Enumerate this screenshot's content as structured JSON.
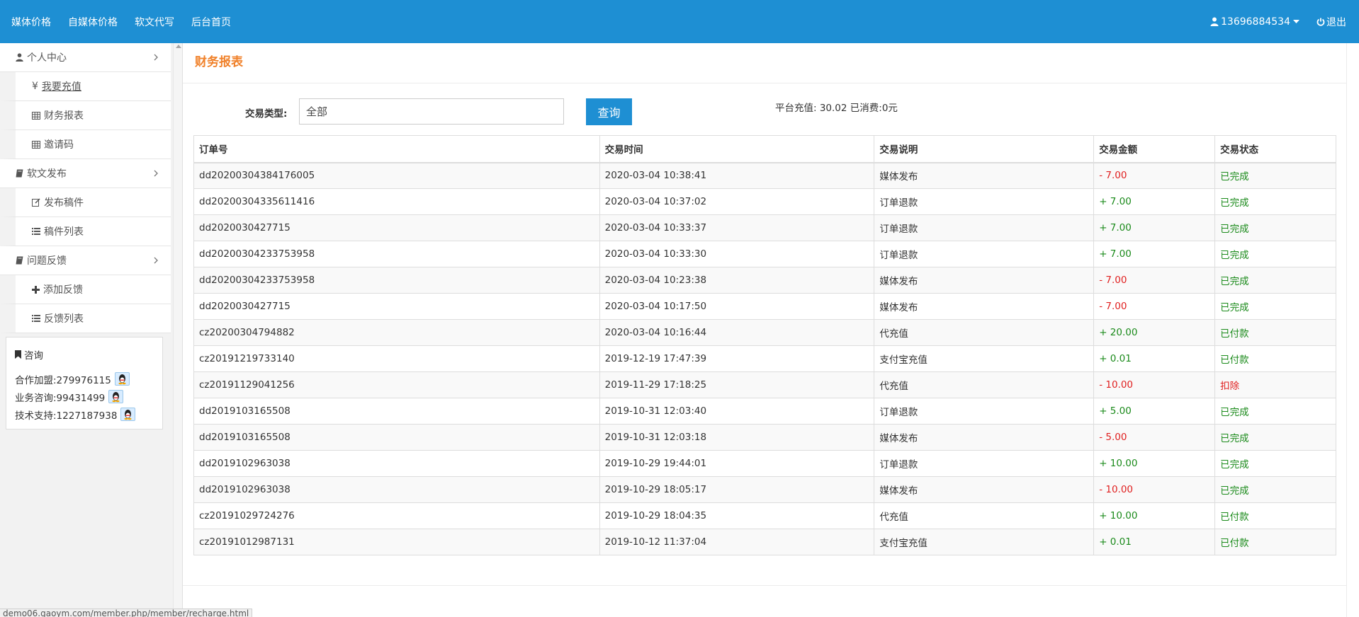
{
  "topnav": {
    "links": [
      "媒体价格",
      "自媒体价格",
      "软文代写",
      "后台首页"
    ],
    "user": "13696884534",
    "logout": "退出"
  },
  "sidebar": {
    "groups": [
      {
        "label": "个人中心",
        "icon": "user-icon",
        "items": [
          {
            "label": "我要充值",
            "icon": "yen-icon"
          },
          {
            "label": "财务报表",
            "icon": "table-icon"
          },
          {
            "label": "邀请码",
            "icon": "table-icon"
          }
        ]
      },
      {
        "label": "软文发布",
        "icon": "book-icon",
        "items": [
          {
            "label": "发布稿件",
            "icon": "edit-icon"
          },
          {
            "label": "稿件列表",
            "icon": "list-icon"
          }
        ]
      },
      {
        "label": "问题反馈",
        "icon": "book-icon",
        "items": [
          {
            "label": "添加反馈",
            "icon": "plus-icon"
          },
          {
            "label": "反馈列表",
            "icon": "list-icon"
          }
        ]
      }
    ],
    "consult": {
      "title": "咨询",
      "rows": [
        "合作加盟:279976115",
        "业务咨询:99431499",
        "技术支持:1227187938"
      ]
    }
  },
  "main": {
    "title": "财务报表",
    "filter_label": "交易类型:",
    "filter_value": "全部",
    "query_label": "查询",
    "summary": "平台充值: 30.02 已消费:0元",
    "columns": [
      "订单号",
      "交易时间",
      "交易说明",
      "交易金额",
      "交易状态"
    ],
    "rows": [
      [
        "dd20200304384176005",
        "2020-03-04 10:38:41",
        "媒体发布",
        "- 7.00",
        "已完成"
      ],
      [
        "dd20200304335611416",
        "2020-03-04 10:37:02",
        "订单退款",
        "+ 7.00",
        "已完成"
      ],
      [
        "dd2020030427715",
        "2020-03-04 10:33:37",
        "订单退款",
        "+ 7.00",
        "已完成"
      ],
      [
        "dd20200304233753958",
        "2020-03-04 10:33:30",
        "订单退款",
        "+ 7.00",
        "已完成"
      ],
      [
        "dd20200304233753958",
        "2020-03-04 10:23:38",
        "媒体发布",
        "- 7.00",
        "已完成"
      ],
      [
        "dd2020030427715",
        "2020-03-04 10:17:50",
        "媒体发布",
        "- 7.00",
        "已完成"
      ],
      [
        "cz20200304794882",
        "2020-03-04 10:16:44",
        "代充值",
        "+ 20.00",
        "已付款"
      ],
      [
        "cz20191219733140",
        "2019-12-19 17:47:39",
        "支付宝充值",
        "+ 0.01",
        "已付款"
      ],
      [
        "cz20191129041256",
        "2019-11-29 17:18:25",
        "代充值",
        "- 10.00",
        "扣除"
      ],
      [
        "dd2019103165508",
        "2019-10-31 12:03:40",
        "订单退款",
        "+ 5.00",
        "已完成"
      ],
      [
        "dd2019103165508",
        "2019-10-31 12:03:18",
        "媒体发布",
        "- 5.00",
        "已完成"
      ],
      [
        "dd2019102963038",
        "2019-10-29 19:44:01",
        "订单退款",
        "+ 10.00",
        "已完成"
      ],
      [
        "dd2019102963038",
        "2019-10-29 18:05:17",
        "媒体发布",
        "- 10.00",
        "已完成"
      ],
      [
        "cz20191029724276",
        "2019-10-29 18:04:35",
        "代充值",
        "+ 10.00",
        "已付款"
      ],
      [
        "cz20191012987131",
        "2019-10-12 11:37:04",
        "支付宝充值",
        "+ 0.01",
        "已付款"
      ]
    ]
  },
  "status_url": "demo06.gaoym.com/member.php/member/recharge.html",
  "colors": {
    "topbar": "#1e8fd3",
    "title": "#f0812a",
    "positive": "#1a8a1a",
    "negative": "#e02020"
  }
}
